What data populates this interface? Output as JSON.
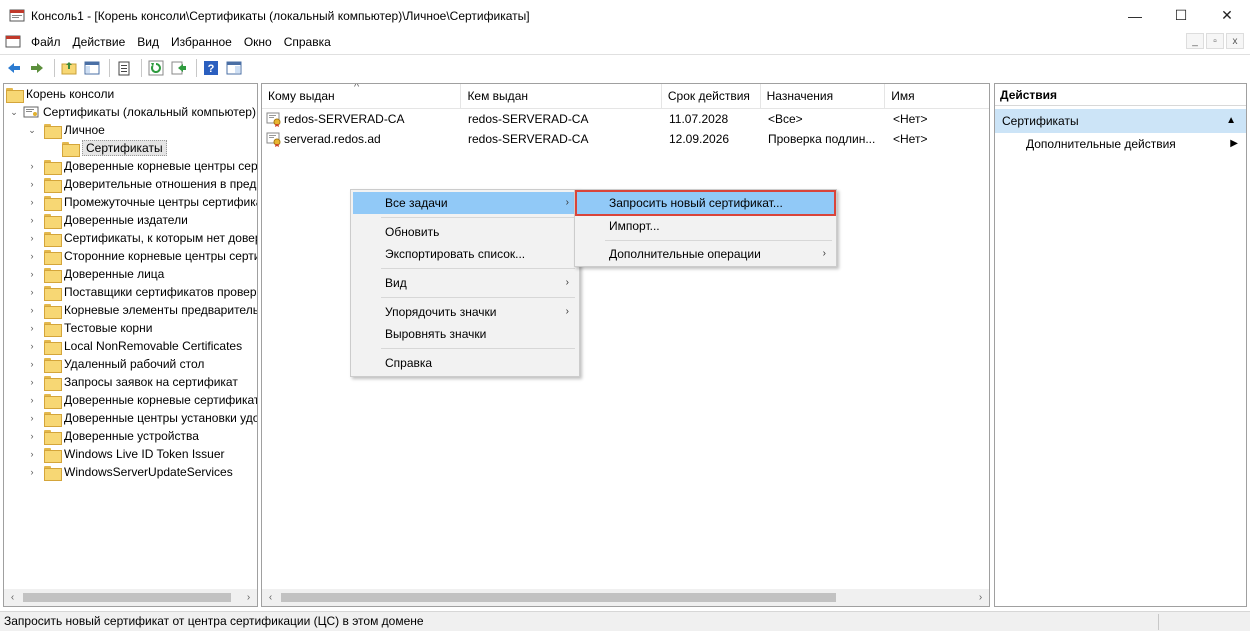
{
  "window": {
    "title": "Консоль1 - [Корень консоли\\Сертификаты (локальный компьютер)\\Личное\\Сертификаты]",
    "minimize": "—",
    "maximize": "☐",
    "close": "✕"
  },
  "menu": {
    "items": [
      "Файл",
      "Действие",
      "Вид",
      "Избранное",
      "Окно",
      "Справка"
    ],
    "mdi_minimize": "_",
    "mdi_restore": "▫",
    "mdi_close": "x"
  },
  "toolbar": {
    "icons": [
      "back-arrow-icon",
      "forward-arrow-icon",
      "up-folder-icon",
      "show-hide-tree-icon",
      "clipboard-icon",
      "refresh-icon",
      "export-icon",
      "help-icon",
      "mmc-view-icon"
    ]
  },
  "tree": {
    "root": "Корень консоли",
    "store": "Сертификаты (локальный компьютер)",
    "personal": "Личное",
    "certificates": "Сертификаты",
    "folders": [
      "Доверенные корневые центры сертификации",
      "Доверительные отношения в предприятии",
      "Промежуточные центры сертификации",
      "Доверенные издатели",
      "Сертификаты, к которым нет доверия",
      "Сторонние корневые центры сертификации",
      "Доверенные лица",
      "Поставщики сертификатов проверки подлинности клиентов",
      "Корневые элементы предварительного просмотра",
      "Тестовые корни",
      "Local NonRemovable Certificates",
      "Удаленный рабочий стол",
      "Запросы заявок на сертификат",
      "Доверенные корневые сертификаты смарт-карты",
      "Доверенные центры установки удостоверений",
      "Доверенные устройства",
      "Windows Live ID Token Issuer",
      "WindowsServerUpdateServices"
    ]
  },
  "list": {
    "columns": [
      "Кому выдан",
      "Кем выдан",
      "Срок действия",
      "Назначения",
      "Имя"
    ],
    "rows": [
      [
        "redos-SERVERAD-CA",
        "redos-SERVERAD-CA",
        "11.07.2028",
        "<Все>",
        "<Нет>"
      ],
      [
        "serverad.redos.ad",
        "redos-SERVERAD-CA",
        "12.09.2026",
        "Проверка подлин...",
        "<Нет>"
      ]
    ],
    "sort_indicator": "^"
  },
  "actions": {
    "header": "Действия",
    "section": "Сертификаты",
    "item": "Дополнительные действия"
  },
  "context_menu": {
    "items": {
      "all_tasks": "Все задачи",
      "refresh": "Обновить",
      "export": "Экспортировать список...",
      "view": "Вид",
      "arrange": "Упорядочить значки",
      "align": "Выровнять значки",
      "help": "Справка"
    },
    "submenu": {
      "request": "Запросить новый сертификат...",
      "import": "Импорт...",
      "advanced": "Дополнительные операции"
    },
    "arrow": "›"
  },
  "status": "Запросить новый сертификат от центра сертификации (ЦС) в этом домене",
  "colors": {
    "highlight": "#91c9f7",
    "section": "#cce4f7",
    "outline": "#d9443a",
    "folder": "#f7d774"
  }
}
